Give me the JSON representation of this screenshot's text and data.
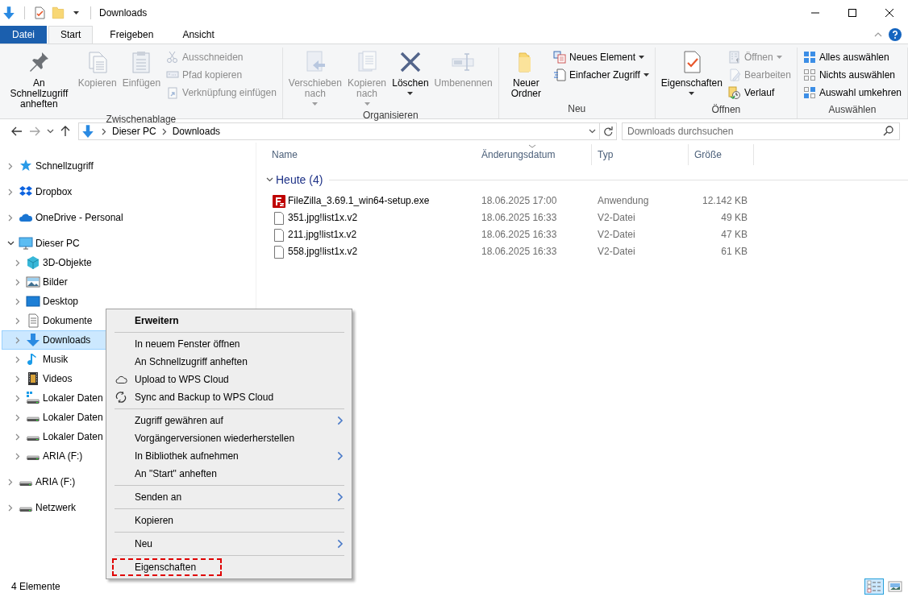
{
  "window": {
    "title": "Downloads"
  },
  "ribbon": {
    "tabs": [
      {
        "label": "Datei",
        "kind": "file",
        "selected": false
      },
      {
        "label": "Start",
        "kind": "tab",
        "selected": true
      },
      {
        "label": "Freigeben",
        "kind": "tab",
        "selected": false
      },
      {
        "label": "Ansicht",
        "kind": "tab",
        "selected": false
      }
    ],
    "groups": [
      {
        "label": "Zwischenablage",
        "large": [
          {
            "label": "An Schnellzugriff anheften",
            "disabled": false,
            "dropdown": false
          },
          {
            "label": "Kopieren",
            "disabled": true,
            "dropdown": false
          },
          {
            "label": "Einfügen",
            "disabled": true,
            "dropdown": false
          }
        ],
        "small": [
          {
            "label": "Ausschneiden",
            "disabled": true,
            "dropdown": false
          },
          {
            "label": "Pfad kopieren",
            "disabled": true,
            "dropdown": false
          },
          {
            "label": "Verknüpfung einfügen",
            "disabled": true,
            "dropdown": false
          }
        ]
      },
      {
        "label": "Organisieren",
        "large": [
          {
            "label": "Verschieben nach",
            "disabled": true,
            "dropdown": true
          },
          {
            "label": "Kopieren nach",
            "disabled": true,
            "dropdown": true
          },
          {
            "label": "Löschen",
            "disabled": false,
            "dropdown": true
          },
          {
            "label": "Umbenennen",
            "disabled": true,
            "dropdown": false
          }
        ]
      },
      {
        "label": "Neu",
        "large": [
          {
            "label": "Neuer Ordner",
            "disabled": false,
            "dropdown": false
          }
        ],
        "small": [
          {
            "label": "Neues Element",
            "disabled": false,
            "dropdown": true
          },
          {
            "label": "Einfacher Zugriff",
            "disabled": false,
            "dropdown": true
          }
        ]
      },
      {
        "label": "Öffnen",
        "large": [
          {
            "label": "Eigenschaften",
            "disabled": false,
            "dropdown": true
          }
        ],
        "small": [
          {
            "label": "Öffnen",
            "disabled": true,
            "dropdown": true
          },
          {
            "label": "Bearbeiten",
            "disabled": true,
            "dropdown": false
          },
          {
            "label": "Verlauf",
            "disabled": false,
            "dropdown": false
          }
        ]
      },
      {
        "label": "Auswählen",
        "small": [
          {
            "label": "Alles auswählen",
            "disabled": false,
            "dropdown": false
          },
          {
            "label": "Nichts auswählen",
            "disabled": false,
            "dropdown": false
          },
          {
            "label": "Auswahl umkehren",
            "disabled": false,
            "dropdown": false
          }
        ]
      }
    ]
  },
  "history": {
    "back": {
      "disabled": false
    },
    "forward": {
      "disabled": true
    }
  },
  "address_bar": {
    "path": [
      "Dieser PC",
      "Downloads"
    ]
  },
  "search": {
    "placeholder": "Downloads durchsuchen"
  },
  "navigation": {
    "items": [
      {
        "label": "Schnellzugriff",
        "expanded": false,
        "selected": false
      },
      {
        "label": "Dropbox",
        "expanded": false,
        "selected": false
      },
      {
        "label": "OneDrive - Personal",
        "expanded": false,
        "selected": false
      },
      {
        "label": "Dieser PC",
        "expanded": true,
        "selected": false,
        "children": [
          {
            "label": "3D-Objekte",
            "expanded": false,
            "selected": false
          },
          {
            "label": "Bilder",
            "expanded": false,
            "selected": false
          },
          {
            "label": "Desktop",
            "expanded": false,
            "selected": false
          },
          {
            "label": "Dokumente",
            "expanded": false,
            "selected": false
          },
          {
            "label": "Downloads",
            "expanded": false,
            "selected": true
          },
          {
            "label": "Musik",
            "expanded": false,
            "selected": false
          },
          {
            "label": "Videos",
            "expanded": false,
            "selected": false
          },
          {
            "label": "Lokaler Daten",
            "expanded": false,
            "selected": false
          },
          {
            "label": "Lokaler Daten",
            "expanded": false,
            "selected": false
          },
          {
            "label": "Lokaler Daten",
            "expanded": false,
            "selected": false
          },
          {
            "label": "ARIA (F:)",
            "expanded": false,
            "selected": false
          }
        ]
      },
      {
        "label": "ARIA (F:)",
        "expanded": false,
        "selected": false
      },
      {
        "label": "Netzwerk",
        "expanded": false,
        "selected": false
      }
    ]
  },
  "file_list": {
    "columns": [
      {
        "label": "Name",
        "sorted": false
      },
      {
        "label": "Änderungsdatum",
        "sorted": true
      },
      {
        "label": "Typ",
        "sorted": false
      },
      {
        "label": "Größe",
        "sorted": false
      }
    ],
    "groups": [
      {
        "label": "Heute (4)",
        "expanded": true,
        "rows": [
          {
            "kind": "application",
            "name": "FileZilla_3.69.1_win64-setup.exe",
            "date": "18.06.2025 17:00",
            "type": "Anwendung",
            "size": "12.142 KB"
          },
          {
            "kind": "file",
            "name": "351.jpg!list1x.v2",
            "date": "18.06.2025 16:33",
            "type": "V2-Datei",
            "size": "49 KB"
          },
          {
            "kind": "file",
            "name": "211.jpg!list1x.v2",
            "date": "18.06.2025 16:33",
            "type": "V2-Datei",
            "size": "47 KB"
          },
          {
            "kind": "file",
            "name": "558.jpg!list1x.v2",
            "date": "18.06.2025 16:33",
            "type": "V2-Datei",
            "size": "61 KB"
          }
        ]
      }
    ]
  },
  "context_menu": {
    "sections": [
      {
        "items": [
          {
            "label": "Erweitern",
            "kind": "plain",
            "default": true,
            "submenu": false,
            "marked": false
          }
        ]
      },
      {
        "items": [
          {
            "label": "In neuem Fenster öffnen",
            "kind": "plain",
            "default": false,
            "submenu": false,
            "marked": false
          },
          {
            "label": "An Schnellzugriff anheften",
            "kind": "plain",
            "default": false,
            "submenu": false,
            "marked": false
          },
          {
            "label": "Upload to WPS Cloud",
            "kind": "cloud",
            "default": false,
            "submenu": false,
            "marked": false
          },
          {
            "label": "Sync and Backup to WPS Cloud",
            "kind": "sync",
            "default": false,
            "submenu": false,
            "marked": false
          }
        ]
      },
      {
        "items": [
          {
            "label": "Zugriff gewähren auf",
            "kind": "plain",
            "default": false,
            "submenu": true,
            "marked": false
          },
          {
            "label": "Vorgängerversionen wiederherstellen",
            "kind": "plain",
            "default": false,
            "submenu": false,
            "marked": false
          },
          {
            "label": "In Bibliothek aufnehmen",
            "kind": "plain",
            "default": false,
            "submenu": true,
            "marked": false
          },
          {
            "label": "An \"Start\" anheften",
            "kind": "plain",
            "default": false,
            "submenu": false,
            "marked": false
          }
        ]
      },
      {
        "items": [
          {
            "label": "Senden an",
            "kind": "plain",
            "default": false,
            "submenu": true,
            "marked": false
          }
        ]
      },
      {
        "items": [
          {
            "label": "Kopieren",
            "kind": "plain",
            "default": false,
            "submenu": false,
            "marked": false
          }
        ]
      },
      {
        "items": [
          {
            "label": "Neu",
            "kind": "plain",
            "default": false,
            "submenu": true,
            "marked": false
          }
        ]
      },
      {
        "items": [
          {
            "label": "Eigenschaften",
            "kind": "plain",
            "default": false,
            "submenu": false,
            "marked": true
          }
        ]
      }
    ]
  },
  "status_bar": {
    "text": "4 Elemente",
    "views": [
      {
        "kind": "details",
        "selected": true
      },
      {
        "kind": "large_icons",
        "selected": false
      }
    ]
  }
}
